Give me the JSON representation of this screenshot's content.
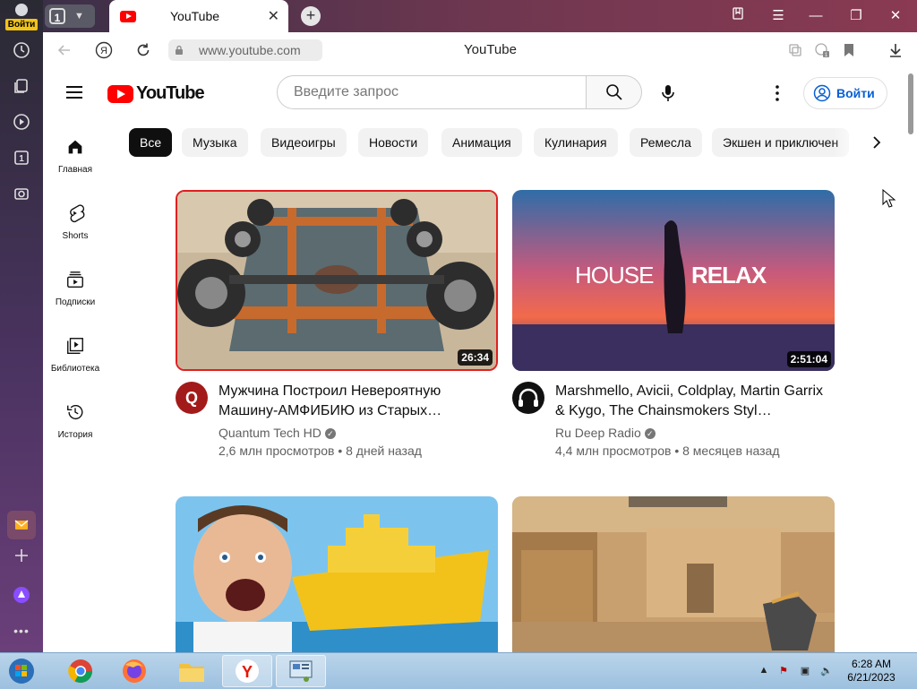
{
  "browser": {
    "login_label": "Войти",
    "tab_count": "1",
    "active_tab_title": "YouTube",
    "url": "www.youtube.com",
    "page_title": "YouTube",
    "colors": {
      "accent": "#ff0000",
      "sidebar_top": "#2a2a33",
      "sidebar_bottom": "#6b3f7a"
    }
  },
  "youtube": {
    "logo_text": "YouTube",
    "search_placeholder": "Введите запрос",
    "signin_label": "Войти",
    "guide": [
      {
        "label": "Главная",
        "icon": "home-icon"
      },
      {
        "label": "Shorts",
        "icon": "shorts-icon"
      },
      {
        "label": "Подписки",
        "icon": "subscriptions-icon"
      },
      {
        "label": "Библиотека",
        "icon": "library-icon"
      },
      {
        "label": "История",
        "icon": "history-icon"
      }
    ],
    "chips": [
      "Все",
      "Музыка",
      "Видеоигры",
      "Новости",
      "Анимация",
      "Кулинария",
      "Ремесла",
      "Экшен и приключен"
    ],
    "videos": [
      {
        "title": "Мужчина Построил Невероятную Машину-АМФИБИЮ из Старых…",
        "channel": "Quantum Tech HD",
        "meta": "2,6 млн просмотров • 8 дней назад",
        "duration": "26:34",
        "avatar_letter": "Q"
      },
      {
        "title": "Marshmello, Avicii, Coldplay, Martin Garrix & Kygo, The Chainsmokers Styl…",
        "channel": "Ru Deep Radio",
        "meta": "4,4 млн просмотров • 8 месяцев назад",
        "duration": "2:51:04",
        "thumb_text_left": "HOUSE",
        "thumb_text_right": "RELAX"
      }
    ]
  },
  "taskbar": {
    "time": "6:28 AM",
    "date": "6/21/2023"
  }
}
